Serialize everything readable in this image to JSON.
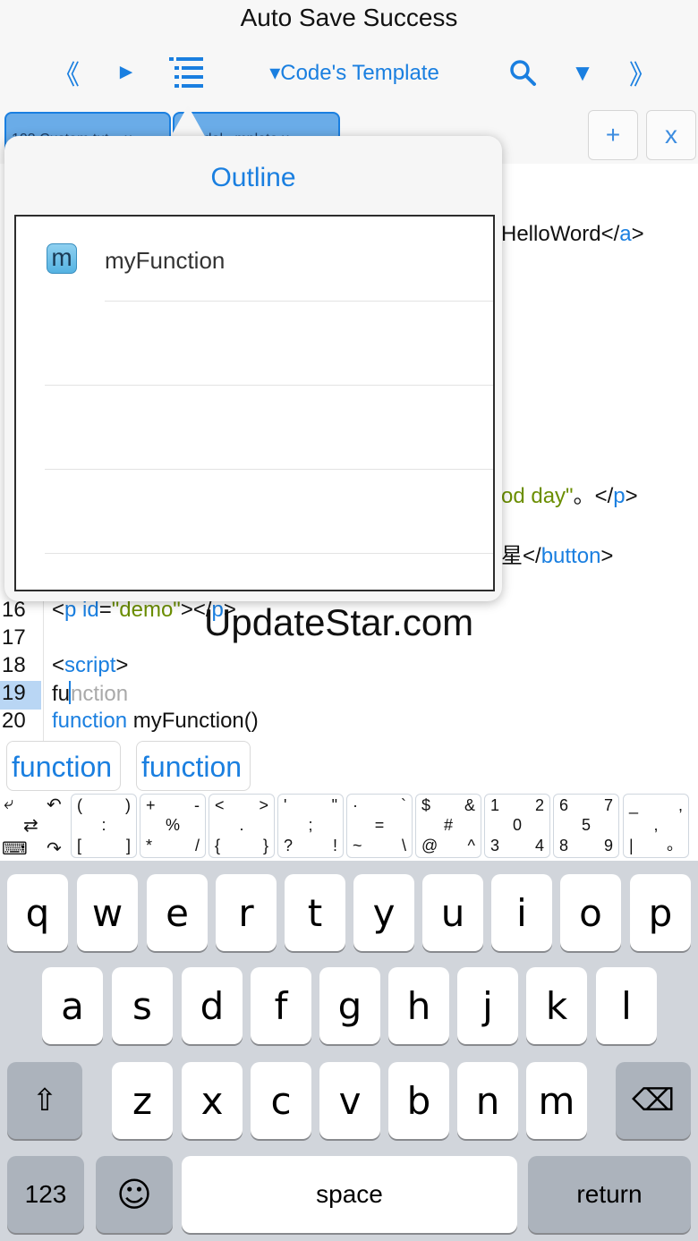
{
  "status": {
    "title": "Auto Save Success"
  },
  "toolbar": {
    "prev_glyph": "《",
    "run_glyph": "►",
    "template_label": "▾Code's Template",
    "search_glyph": "⚲",
    "filter_glyph": "▼",
    "next_glyph": "》"
  },
  "tabs": [
    {
      "label": "103 Custom.tut... x"
    },
    {
      "label": "m...dal...mplate x"
    }
  ],
  "tab_actions": {
    "add": "+",
    "close": "x"
  },
  "outline": {
    "title": "Outline",
    "items": [
      {
        "badge": "m",
        "label": "myFunction"
      }
    ]
  },
  "editor": {
    "visible_fragments": {
      "hello": [
        "HelloWord",
        "</",
        "a",
        ">"
      ],
      "good_day": [
        "od day\"",
        "。</",
        "p",
        ">"
      ],
      "button": [
        "星</",
        "button",
        ">"
      ]
    },
    "lines": [
      {
        "num": "16",
        "parts": [
          [
            "",
            "<"
          ],
          [
            "kw",
            "p"
          ],
          [
            "",
            " "
          ],
          [
            "kw",
            "id"
          ],
          [
            "",
            "="
          ],
          [
            "str",
            "\"demo\""
          ],
          [
            "",
            "></"
          ],
          [
            "kw",
            "p"
          ],
          [
            "",
            ">"
          ]
        ]
      },
      {
        "num": "17",
        "parts": []
      },
      {
        "num": "18",
        "parts": [
          [
            "",
            "<"
          ],
          [
            "kw",
            "script"
          ],
          [
            "",
            ">"
          ]
        ]
      },
      {
        "num": "19",
        "active": true,
        "typed": "fu",
        "ghost": "nction"
      },
      {
        "num": "20",
        "parts": [
          [
            "kw",
            "function"
          ],
          [
            "",
            " myFunction()"
          ]
        ]
      }
    ]
  },
  "watermark": "UpdateStar.com",
  "suggestions": [
    "function",
    "function"
  ],
  "symbol_keys": [
    {
      "tl": "(",
      "tr": ")",
      "c": ":",
      "bl": "[",
      "br": "]"
    },
    {
      "tl": "+",
      "tr": "-",
      "c": "%",
      "bl": "*",
      "br": "/"
    },
    {
      "tl": "<",
      "tr": ">",
      "c": ".",
      "bl": "{",
      "br": "}"
    },
    {
      "tl": "'",
      "tr": "\"",
      "c": ";",
      "bl": "?",
      "br": "!"
    },
    {
      "tl": "·",
      "tr": "`",
      "c": "=",
      "bl": "~",
      "br": "\\"
    },
    {
      "tl": "$",
      "tr": "&",
      "c": "#",
      "bl": "@",
      "br": "^"
    },
    {
      "tl": "1",
      "tr": "2",
      "c": "0",
      "bl": "3",
      "br": "4"
    },
    {
      "tl": "6",
      "tr": "7",
      "c": "5",
      "bl": "8",
      "br": "9"
    },
    {
      "tl": "_",
      "tr": ",",
      "c": ",",
      "bl": "|",
      "br": "。"
    }
  ],
  "keyboard": {
    "row1": [
      "q",
      "w",
      "e",
      "r",
      "t",
      "y",
      "u",
      "i",
      "o",
      "p"
    ],
    "row2": [
      "a",
      "s",
      "d",
      "f",
      "g",
      "h",
      "j",
      "k",
      "l"
    ],
    "row3": [
      "z",
      "x",
      "c",
      "v",
      "b",
      "n",
      "m"
    ],
    "shift": "⇧",
    "delete": "⌫",
    "numbers": "123",
    "emoji": "☺",
    "space": "space",
    "return": "return"
  }
}
